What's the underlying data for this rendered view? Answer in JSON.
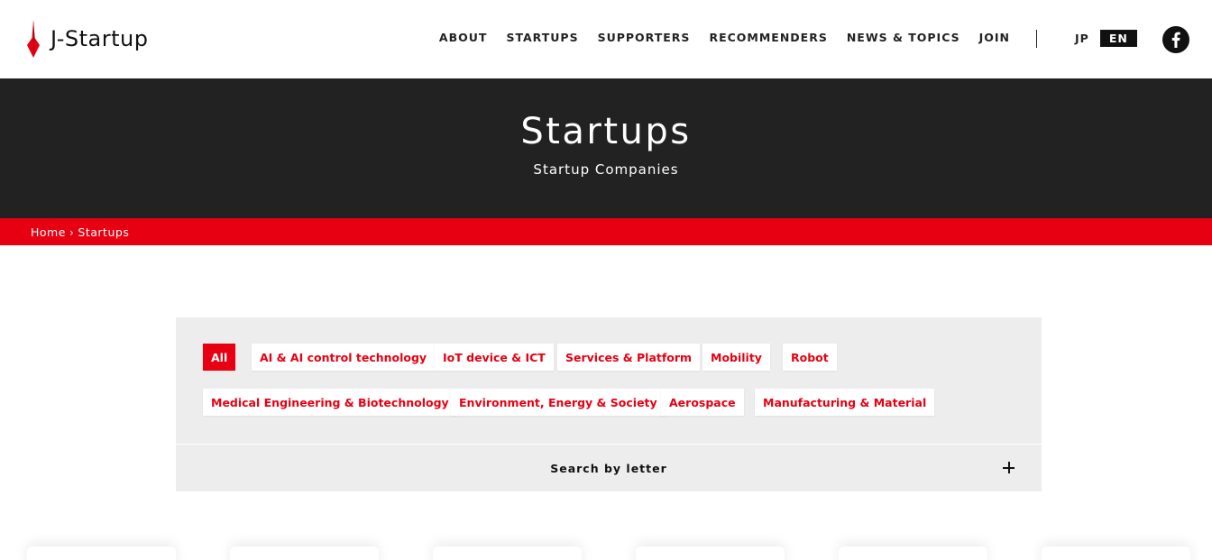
{
  "brand": {
    "name": "J-Startup",
    "accent": "#e60012",
    "dark": "#222222"
  },
  "nav": {
    "items": [
      {
        "label": "ABOUT"
      },
      {
        "label": "STARTUPS"
      },
      {
        "label": "SUPPORTERS"
      },
      {
        "label": "RECOMMENDERS"
      },
      {
        "label": "NEWS & TOPICS"
      },
      {
        "label": "JOIN"
      }
    ],
    "lang_jp": "JP",
    "lang_en": "EN",
    "social_icon": "facebook-icon"
  },
  "hero": {
    "title": "Startups",
    "subtitle": "Startup Companies"
  },
  "breadcrumb": {
    "home": "Home",
    "separator": "›",
    "current": "Startups"
  },
  "filters": {
    "categories": [
      {
        "label": "All",
        "active": true
      },
      {
        "label": "AI & AI control technology"
      },
      {
        "label": "IoT device & ICT"
      },
      {
        "label": "Services & Platform"
      },
      {
        "label": "Mobility"
      },
      {
        "label": "Robot"
      },
      {
        "label": "Medical Engineering & Biotechnology"
      },
      {
        "label": "Environment, Energy & Society"
      },
      {
        "label": "Aerospace"
      },
      {
        "label": "Manufacturing & Material"
      }
    ],
    "letter_search_label": "Search by letter",
    "expand_icon": "plus-icon"
  }
}
